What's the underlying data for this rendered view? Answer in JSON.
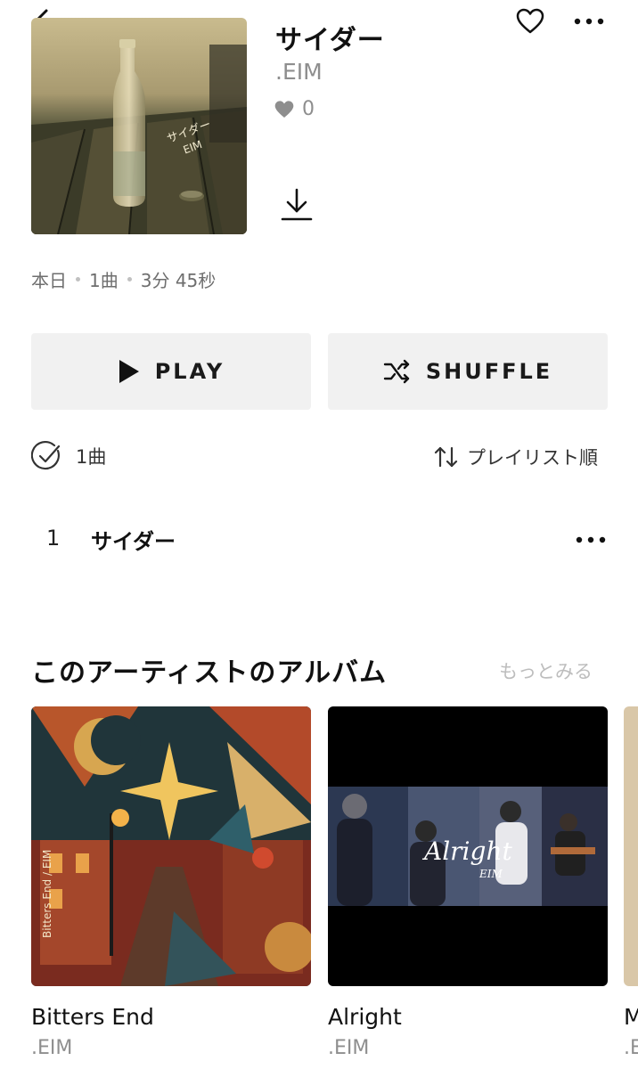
{
  "header": {
    "back_icon": "chevron-left-icon",
    "favorite_icon": "heart-outline-icon",
    "more_icon": "more-horizontal-icon"
  },
  "album": {
    "title": "サイダー",
    "artist": ".EIM",
    "likes": "0",
    "cover_text_line1": "サイダー",
    "cover_text_line2": "EIM",
    "download_icon": "download-icon"
  },
  "meta": {
    "date": "本日",
    "track_count": "1曲",
    "duration": "3分 45秒"
  },
  "actions": {
    "play_label": "PLAY",
    "shuffle_label": "SHUFFLE"
  },
  "list_controls": {
    "select_label": "1曲",
    "sort_label": "プレイリスト順"
  },
  "tracks": [
    {
      "number": "1",
      "title": "サイダー"
    }
  ],
  "artist_albums": {
    "heading": "このアーティストのアルバム",
    "see_more": "もっとみる",
    "items": [
      {
        "title": "Bitters End",
        "artist": ".EIM",
        "cover_text": "Bitters End / EIM"
      },
      {
        "title": "Alright",
        "artist": ".EIM",
        "cover_text": "Alright",
        "cover_subtext": "EIM"
      },
      {
        "title": "M",
        "artist": ".E"
      }
    ]
  },
  "colors": {
    "text_primary": "#111111",
    "text_secondary": "#8e8e8e",
    "button_bg": "#f1f1f1",
    "link_muted": "#bdbdbd"
  }
}
